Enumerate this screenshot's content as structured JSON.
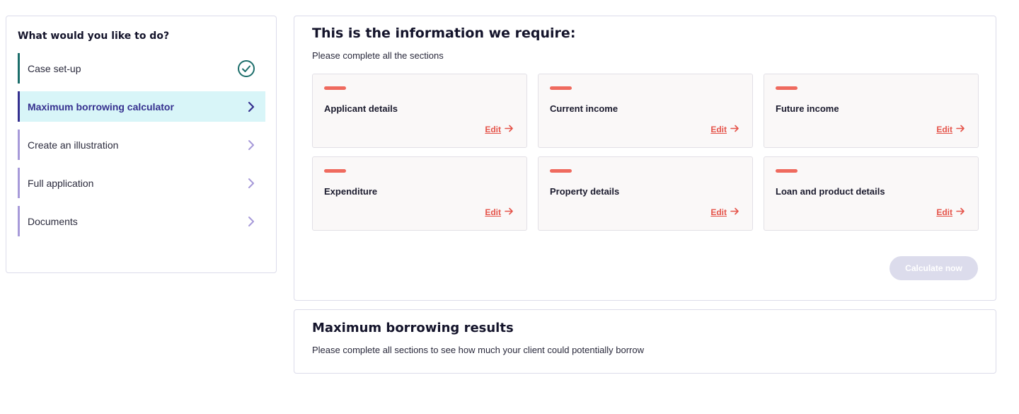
{
  "sidebar": {
    "heading": "What would you like to do?",
    "items": [
      {
        "label": "Case set-up",
        "status": "complete",
        "icon": "check-circle-icon"
      },
      {
        "label": "Maximum borrowing calculator",
        "status": "active",
        "icon": "chevron-right-icon"
      },
      {
        "label": "Create an illustration",
        "status": "pending",
        "icon": "chevron-right-icon"
      },
      {
        "label": "Full application",
        "status": "pending",
        "icon": "chevron-right-icon"
      },
      {
        "label": "Documents",
        "status": "pending",
        "icon": "chevron-right-icon"
      }
    ]
  },
  "requirements": {
    "title": "This is the information we require:",
    "subtitle": "Please complete all the sections",
    "sections": [
      {
        "label": "Applicant details",
        "edit_label": "Edit",
        "status": "incomplete"
      },
      {
        "label": "Current income",
        "edit_label": "Edit",
        "status": "incomplete"
      },
      {
        "label": "Future income",
        "edit_label": "Edit",
        "status": "incomplete"
      },
      {
        "label": "Expenditure",
        "edit_label": "Edit",
        "status": "incomplete"
      },
      {
        "label": "Property details",
        "edit_label": "Edit",
        "status": "incomplete"
      },
      {
        "label": "Loan and product details",
        "edit_label": "Edit",
        "status": "incomplete"
      }
    ],
    "calculate_label": "Calculate now",
    "calculate_disabled": true
  },
  "results": {
    "title": "Maximum borrowing results",
    "text": "Please complete all sections to see how much your client could potentially borrow"
  },
  "colors": {
    "accent_primary": "#35308f",
    "accent_teal": "#1b6d6a",
    "active_bg": "#d8f5f8",
    "nav_border": "#a79ad9",
    "incomplete_status": "#ef6a5e",
    "edit_link": "#e5544a",
    "button_disabled": "#dcdcec"
  }
}
